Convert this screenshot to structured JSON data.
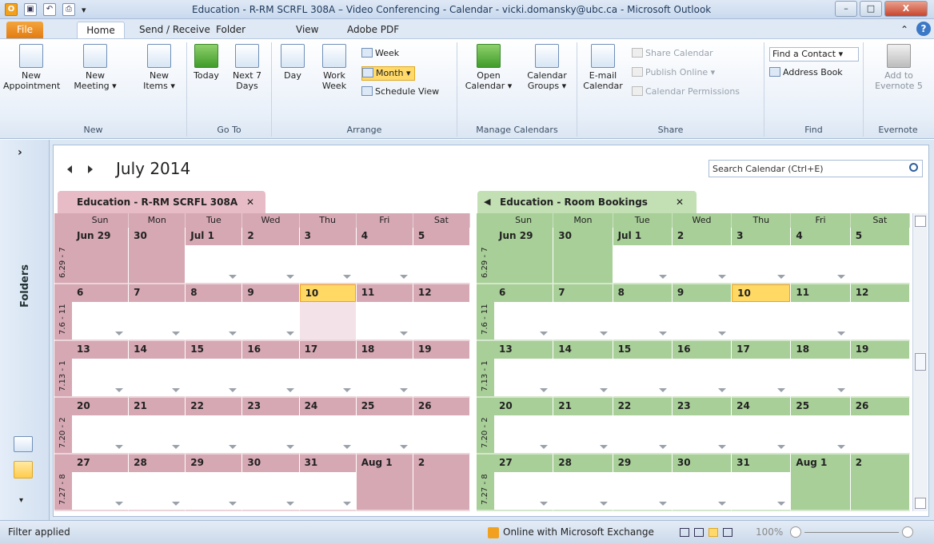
{
  "window": {
    "title": "Education - R-RM SCRFL 308A – Video Conferencing - Calendar - vicki.domansky@ubc.ca - Microsoft Outlook",
    "minimize": "–",
    "maximize": "□",
    "close": "X"
  },
  "qat": {
    "app_icon": "O",
    "save": "▣",
    "undo": "↶",
    "print": "⎙",
    "customize": "▾"
  },
  "tabs": {
    "file": "File",
    "home": "Home",
    "send_receive": "Send / Receive",
    "folder": "Folder",
    "view": "View",
    "adobe": "Adobe PDF",
    "help": "?",
    "collapse": "⌃"
  },
  "ribbon": {
    "new": {
      "appointment": "New\nAppointment",
      "meeting": "New\nMeeting ▾",
      "items": "New\nItems ▾",
      "label": "New"
    },
    "goto": {
      "today": "Today",
      "next7": "Next 7\nDays",
      "label": "Go To"
    },
    "arrange": {
      "day": "Day",
      "workweek": "Work\nWeek",
      "week": "Week",
      "month": "Month",
      "schedule": "Schedule View",
      "label": "Arrange"
    },
    "manage": {
      "open": "Open\nCalendar ▾",
      "groups": "Calendar\nGroups ▾",
      "label": "Manage Calendars"
    },
    "share": {
      "email": "E-mail\nCalendar",
      "share": "Share Calendar",
      "publish": "Publish Online ▾",
      "permissions": "Calendar Permissions",
      "label": "Share"
    },
    "find": {
      "contact": "Find a Contact ▾",
      "book": "Address Book",
      "label": "Find"
    },
    "evernote": {
      "add": "Add to\nEvernote 5",
      "label": "Evernote"
    }
  },
  "nav": {
    "expand": "›",
    "folders": "Folders",
    "more": "▾"
  },
  "calendar": {
    "month_title": "July 2014",
    "search_placeholder": "Search Calendar (Ctrl+E)"
  },
  "cal1": {
    "tab": "Education - R-RM SCRFL 308A",
    "close": "✕",
    "color": "#d6a8b4",
    "tabcolor": "#e7bcc6"
  },
  "cal2": {
    "tab": "Education - Room Bookings",
    "close": "✕",
    "back": "◀",
    "color": "#a8cf98",
    "tabcolor": "#c2e0b4"
  },
  "days": [
    "Sun",
    "Mon",
    "Tue",
    "Wed",
    "Thu",
    "Fri",
    "Sat"
  ],
  "weeks": [
    {
      "label": "6.29 - 7",
      "days": [
        "Jun 29",
        "30",
        "Jul 1",
        "2",
        "3",
        "4",
        "5"
      ]
    },
    {
      "label": "7.6 - 11",
      "days": [
        "6",
        "7",
        "8",
        "9",
        "10",
        "11",
        "12"
      ]
    },
    {
      "label": "7.13 - 1",
      "days": [
        "13",
        "14",
        "15",
        "16",
        "17",
        "18",
        "19"
      ]
    },
    {
      "label": "7.20 - 2",
      "days": [
        "20",
        "21",
        "22",
        "23",
        "24",
        "25",
        "26"
      ]
    },
    {
      "label": "7.27 - 8",
      "days": [
        "27",
        "28",
        "29",
        "30",
        "31",
        "Aug 1",
        "2"
      ]
    }
  ],
  "status": {
    "filter": "Filter applied",
    "exchange": "Online with Microsoft Exchange",
    "zoom": "100%"
  }
}
